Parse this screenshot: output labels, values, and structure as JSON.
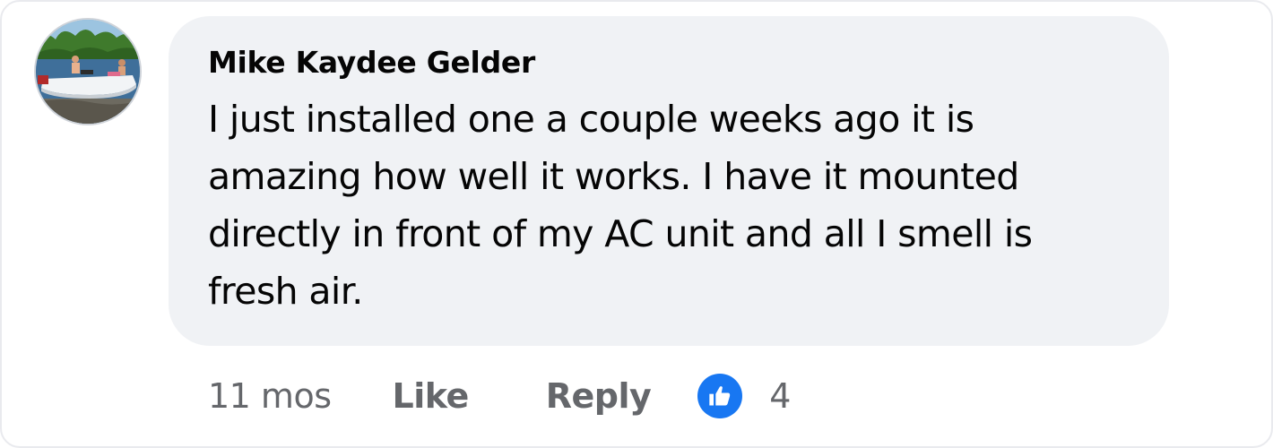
{
  "comment": {
    "author": "Mike Kaydee Gelder",
    "text": "I just installed one a couple weeks ago it is amazing how well it works. I have it mounted directly in front of my AC unit and all I smell is fresh air.",
    "timestamp": "11 mos",
    "like_label": "Like",
    "reply_label": "Reply",
    "reaction_icon": "thumbs-up-icon",
    "reaction_count": "4"
  },
  "colors": {
    "bubble_bg": "#f0f2f5",
    "text": "#050505",
    "secondary_text": "#65676b",
    "like_blue": "#1877f2"
  }
}
